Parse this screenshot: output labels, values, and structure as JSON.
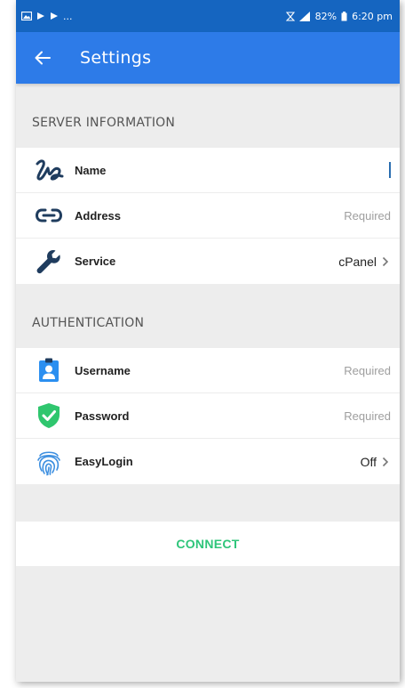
{
  "status_bar": {
    "left_ellipsis": "...",
    "battery": "82%",
    "time": "6:20 pm"
  },
  "app_bar": {
    "title": "Settings"
  },
  "sections": {
    "server": {
      "header": "SERVER INFORMATION",
      "rows": [
        {
          "label": "Name",
          "value": ""
        },
        {
          "label": "Address",
          "value": "Required"
        },
        {
          "label": "Service",
          "value": "cPanel"
        }
      ]
    },
    "auth": {
      "header": "AUTHENTICATION",
      "rows": [
        {
          "label": "Username",
          "value": "Required"
        },
        {
          "label": "Password",
          "value": "Required"
        },
        {
          "label": "EasyLogin",
          "value": "Off"
        }
      ]
    }
  },
  "connect": {
    "label": "CONNECT"
  },
  "colors": {
    "status_bar": "#1565c0",
    "app_bar": "#2d7be8",
    "connect_accent": "#2ec57a",
    "icon_navy": "#1f3c5e",
    "username_blue": "#2b8ff0",
    "password_green": "#2fc66e"
  },
  "icons": {
    "name": "signature-icon",
    "address": "link-icon",
    "service": "wrench-icon",
    "username": "user-badge-icon",
    "password": "shield-check-icon",
    "easylogin": "fingerprint-icon"
  }
}
